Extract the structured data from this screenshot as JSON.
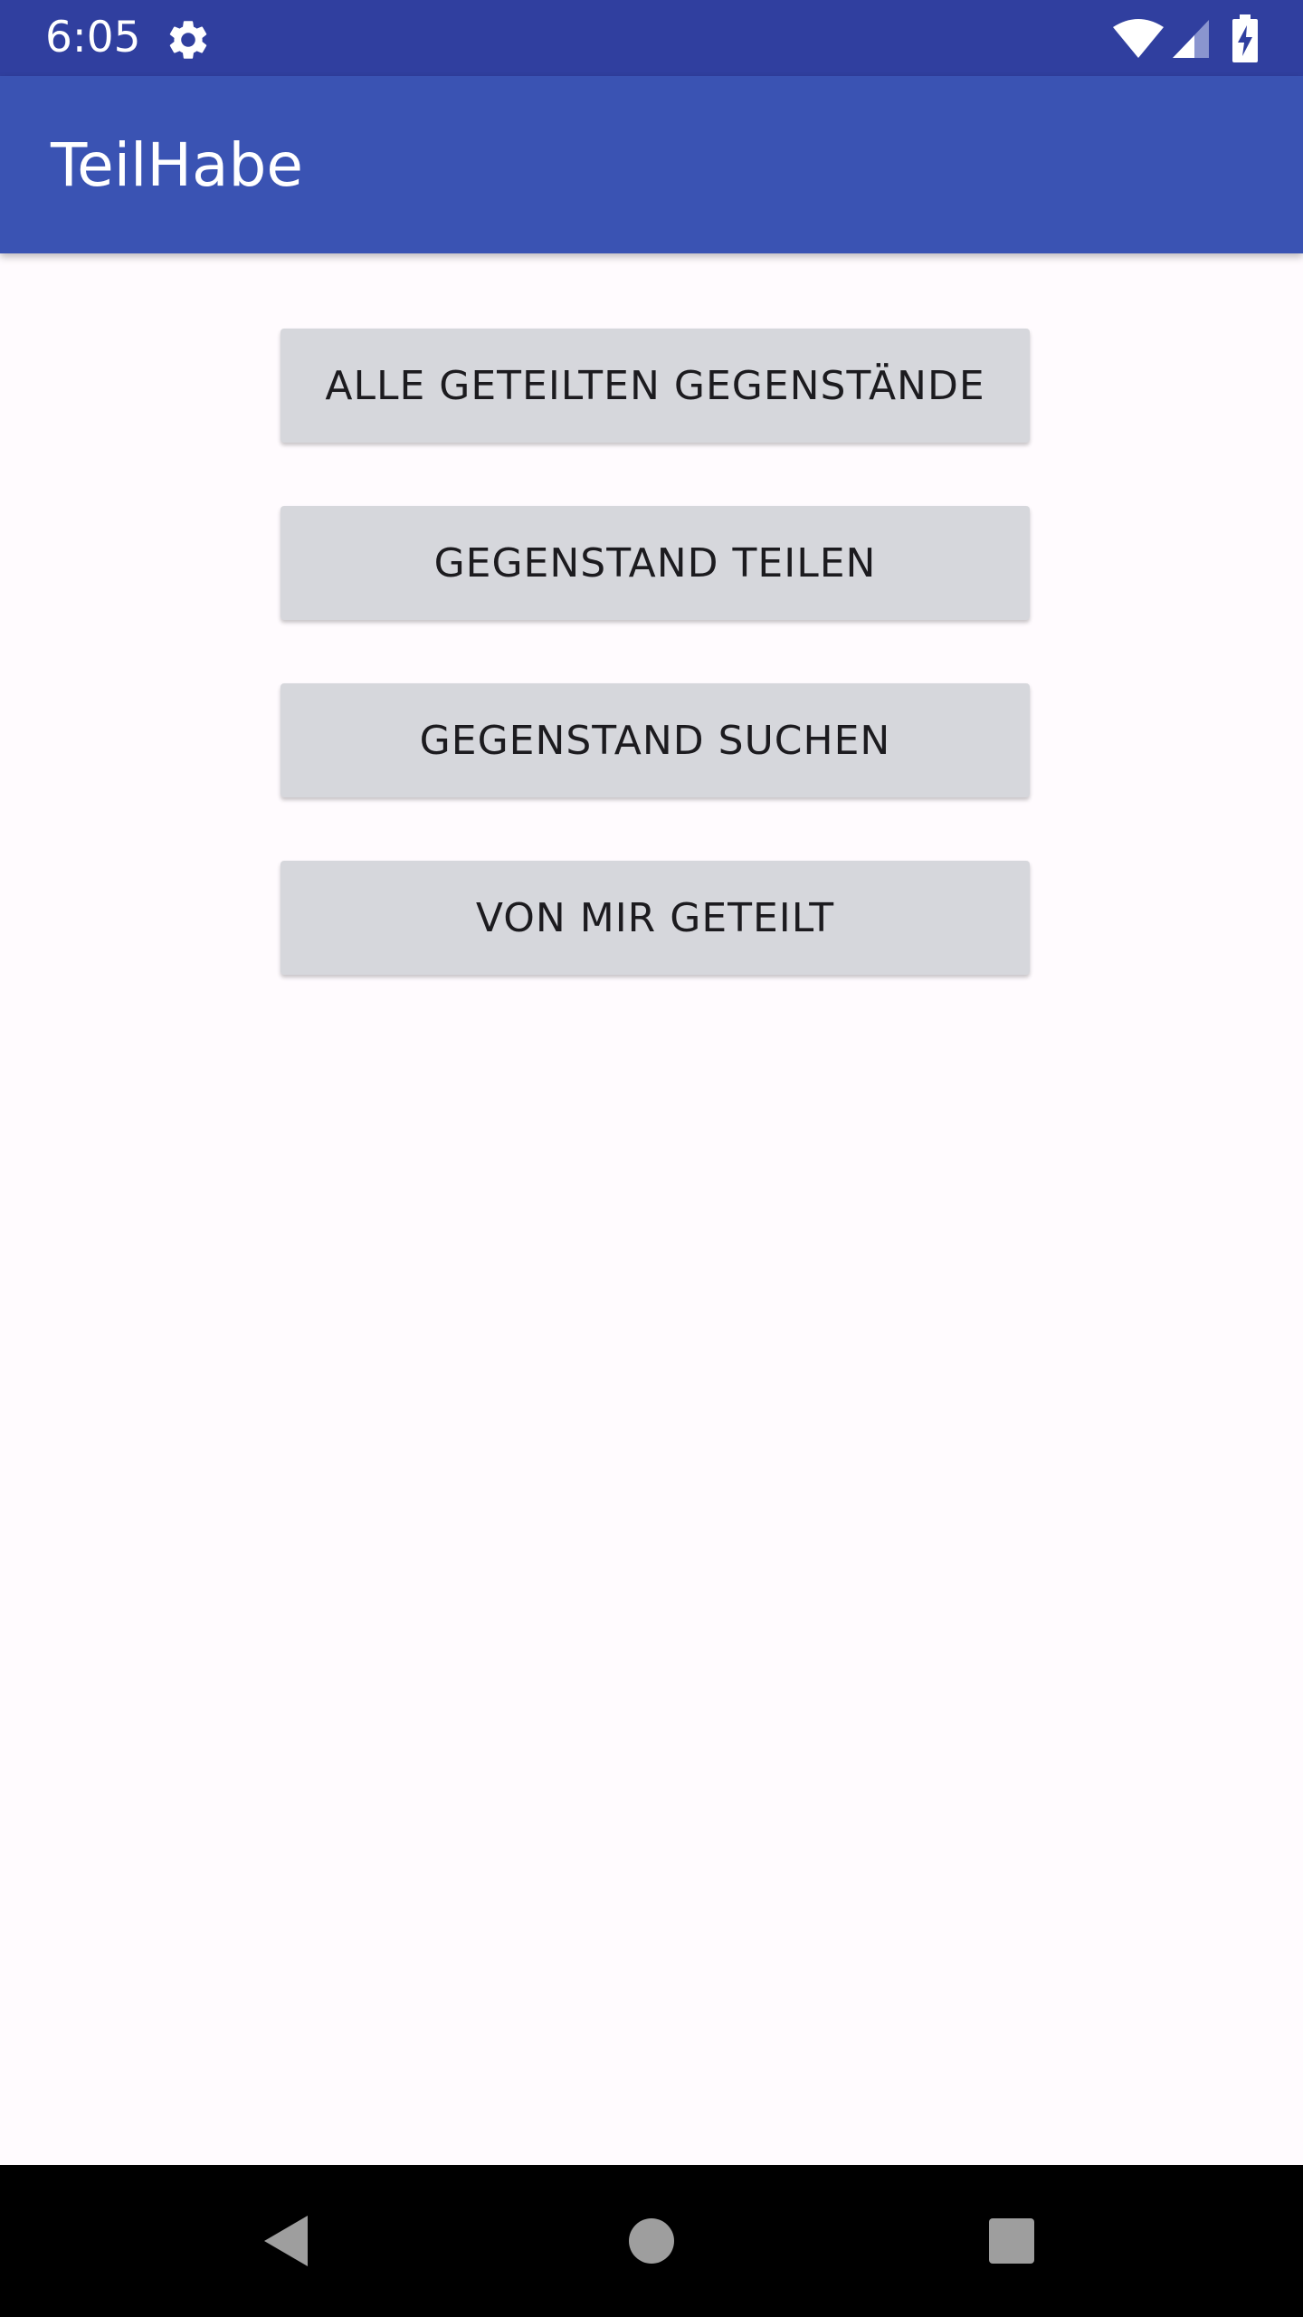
{
  "status_bar": {
    "time": "6:05",
    "icons": [
      "gear-icon",
      "wifi-icon",
      "cell-signal-icon",
      "battery-charging-icon"
    ],
    "background_color": "#303F9F"
  },
  "app_bar": {
    "title": "TeilHabe",
    "background_color": "#3A53B3"
  },
  "main": {
    "buttons": [
      {
        "label": "ALLE GETEILTEN GEGENSTÄNDE"
      },
      {
        "label": "GEGENSTAND TEILEN"
      },
      {
        "label": "GEGENSTAND SUCHEN"
      },
      {
        "label": "VON MIR GETEILT"
      }
    ],
    "button_color": "#D6D7DC"
  },
  "nav_bar": {
    "icons": [
      "back-icon",
      "home-icon",
      "recents-icon"
    ]
  }
}
